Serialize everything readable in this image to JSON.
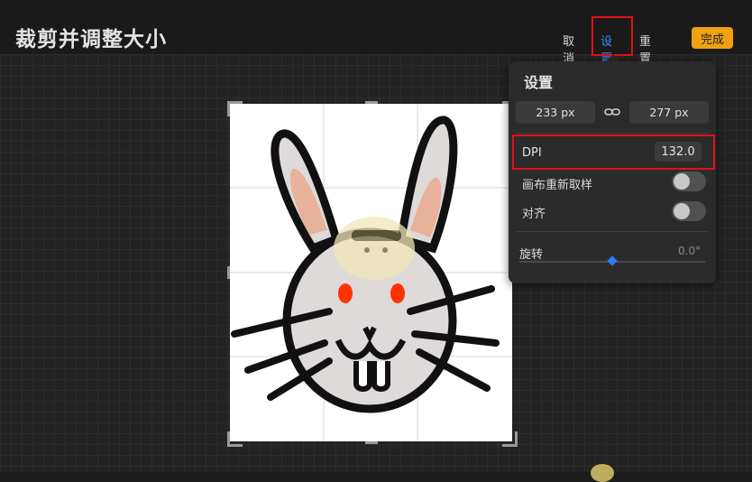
{
  "header": {
    "title": "裁剪并调整大小",
    "cancel_label": "取消",
    "settings_label": "设置",
    "reset_label": "重置",
    "done_label": "完成"
  },
  "settings_panel": {
    "title": "设置",
    "width_value": "233 px",
    "height_value": "277 px",
    "dpi_label": "DPI",
    "dpi_value": "132.0",
    "resample_label": "画布重新取样",
    "resample_on": false,
    "snap_label": "对齐",
    "snap_on": false,
    "rotation_label": "旋转",
    "rotation_value": "0.0°",
    "rotation_level": 0.5
  },
  "icons": {
    "link": "link-icon",
    "rabbit": "rabbit-drawing"
  },
  "colors": {
    "accent_blue": "#3d8bff",
    "done_orange": "#f0a010",
    "highlight_red": "#e3101a"
  }
}
